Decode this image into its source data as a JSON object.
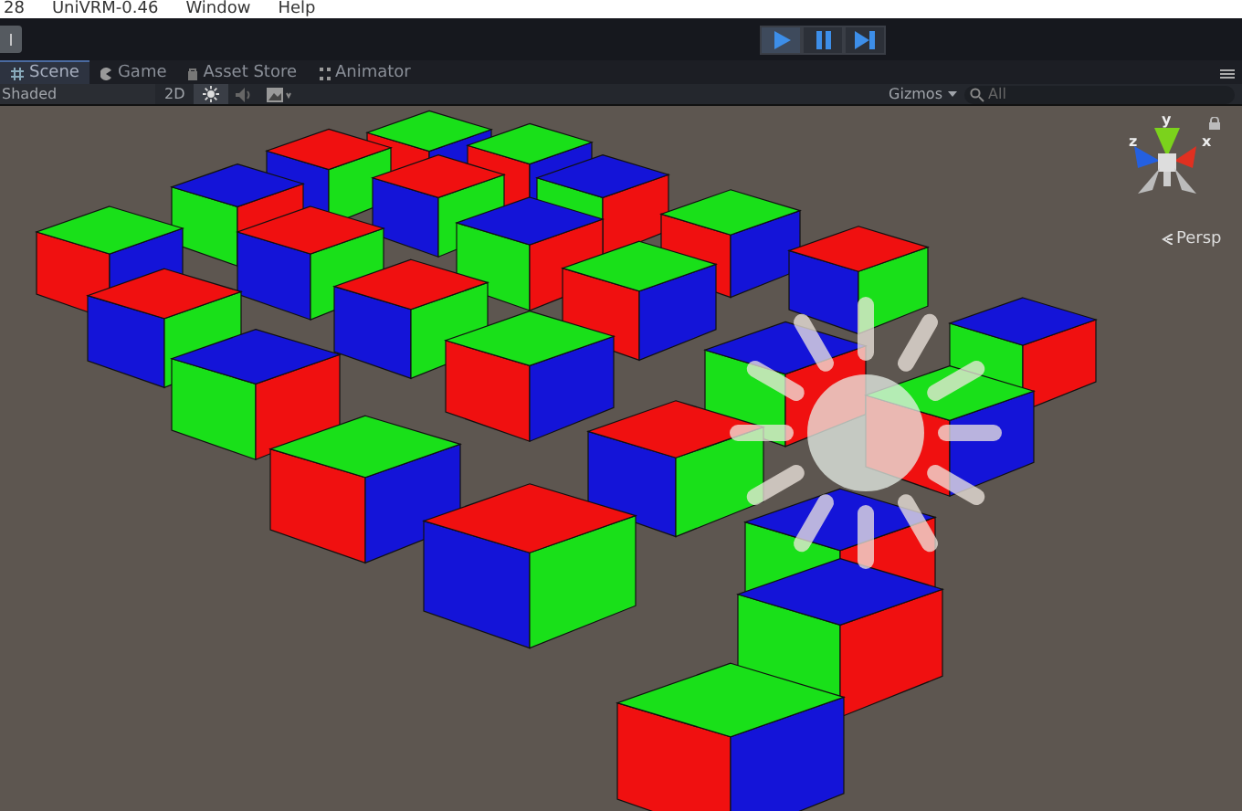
{
  "menu_bar": {
    "items": [
      "28",
      "UniVRM-0.46",
      "Window",
      "Help"
    ]
  },
  "toolbar": {
    "left_button": "l",
    "play": {
      "selected": true
    },
    "pause": {
      "selected": false
    },
    "step": {
      "selected": false
    }
  },
  "tabs": [
    {
      "label": "Scene",
      "selected": true,
      "kind": "scene"
    },
    {
      "label": "Game",
      "selected": false,
      "kind": "game"
    },
    {
      "label": "Asset Store",
      "selected": false,
      "kind": "store"
    },
    {
      "label": "Animator",
      "selected": false,
      "kind": "animator"
    }
  ],
  "scene_toolbar": {
    "draw_mode": "Shaded",
    "mode_2d": "2D",
    "lighting": {
      "on": true
    },
    "gizmos": "Gizmos",
    "search": {
      "placeholder": "All"
    }
  },
  "scene_gizmo": {
    "axis_labels": [
      "y",
      "x",
      "z"
    ],
    "projection": "Persp"
  }
}
